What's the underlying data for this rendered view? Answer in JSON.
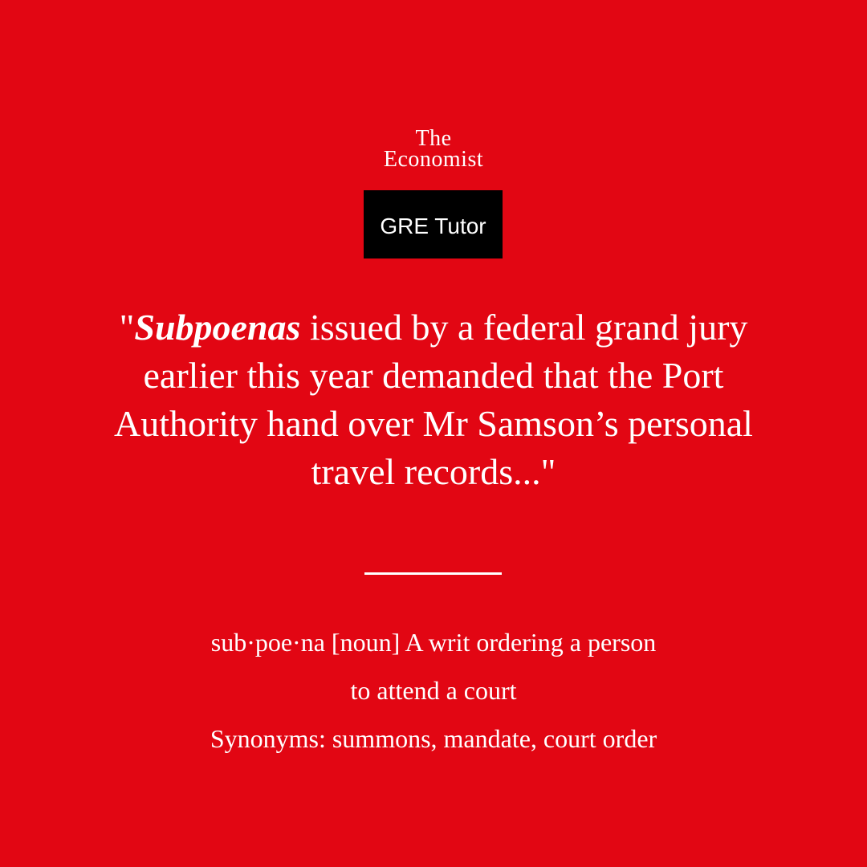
{
  "brand": {
    "line1": "The",
    "line2": "Economist"
  },
  "badge": {
    "label": "GRE Tutor"
  },
  "quote": {
    "open_quote": "\"",
    "keyword": "Subpoenas",
    "rest": " issued by a federal grand jury earlier this year demanded that the Port Authority hand over Mr Samson’s personal travel records...\""
  },
  "definition": {
    "line1": "sub·poe·na [noun] A writ ordering a person",
    "line2": "to attend a court",
    "synonyms": "Synonyms:  summons, mandate, court order"
  },
  "colors": {
    "background": "#E20613",
    "text": "#FFFFFF",
    "badge_bg": "#000000"
  }
}
